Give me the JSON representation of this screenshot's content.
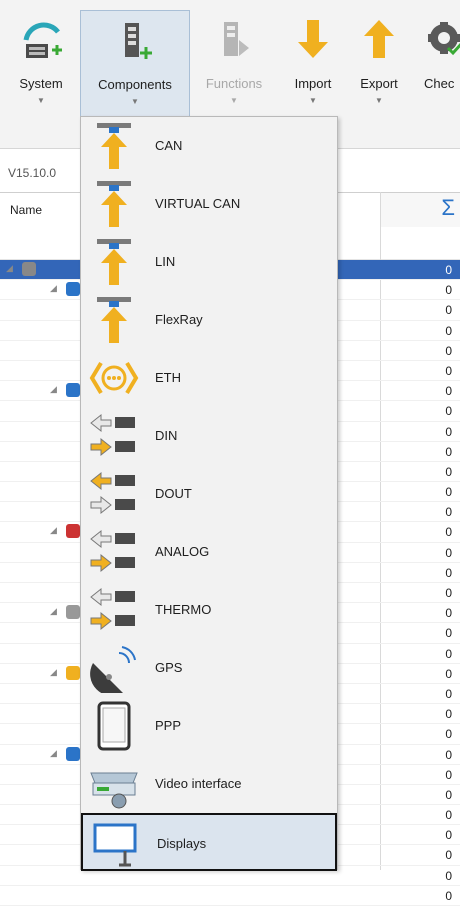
{
  "ribbon": {
    "buttons": [
      {
        "label": "System",
        "icon": "system-add-icon",
        "state": "normal"
      },
      {
        "label": "Components",
        "icon": "components-add-icon",
        "state": "active"
      },
      {
        "label": "Functions",
        "icon": "functions-icon",
        "state": "disabled"
      },
      {
        "label": "Import",
        "icon": "import-arrow-icon",
        "state": "normal"
      },
      {
        "label": "Export",
        "icon": "export-arrow-icon",
        "state": "normal"
      },
      {
        "label": "Chec",
        "icon": "check-gear-icon",
        "state": "normal"
      }
    ]
  },
  "version": "V15.10.0",
  "grid": {
    "name_header": "Name",
    "sum_header": "Σ",
    "values": [
      "0",
      "0",
      "0",
      "0",
      "0",
      "0",
      "0",
      "0",
      "0",
      "0",
      "0",
      "0",
      "0",
      "0",
      "0",
      "0",
      "0",
      "0",
      "0",
      "0",
      "0",
      "0",
      "0",
      "0",
      "0",
      "0",
      "0",
      "0",
      "0",
      "0",
      "0",
      "0"
    ]
  },
  "menu": {
    "items": [
      {
        "label": "CAN",
        "icon": "bus-in-arrow-icon"
      },
      {
        "label": "VIRTUAL CAN",
        "icon": "bus-in-arrow-icon"
      },
      {
        "label": "LIN",
        "icon": "bus-in-arrow-icon"
      },
      {
        "label": "FlexRay",
        "icon": "bus-in-arrow-icon"
      },
      {
        "label": "ETH",
        "icon": "ethernet-icon"
      },
      {
        "label": "DIN",
        "icon": "digital-in-icon"
      },
      {
        "label": "DOUT",
        "icon": "digital-out-icon"
      },
      {
        "label": "ANALOG",
        "icon": "analog-io-icon"
      },
      {
        "label": "THERMO",
        "icon": "thermo-io-icon"
      },
      {
        "label": "GPS",
        "icon": "satellite-dish-icon"
      },
      {
        "label": "PPP",
        "icon": "tablet-icon"
      },
      {
        "label": "Video interface",
        "icon": "video-camera-icon"
      },
      {
        "label": "Displays",
        "icon": "display-icon"
      }
    ],
    "highlighted": "Displays"
  },
  "colors": {
    "accent": "#3366b8",
    "arrow": "#f0b020",
    "menu_bg": "#f2f2f2",
    "highlight": "#dbe4ee"
  }
}
